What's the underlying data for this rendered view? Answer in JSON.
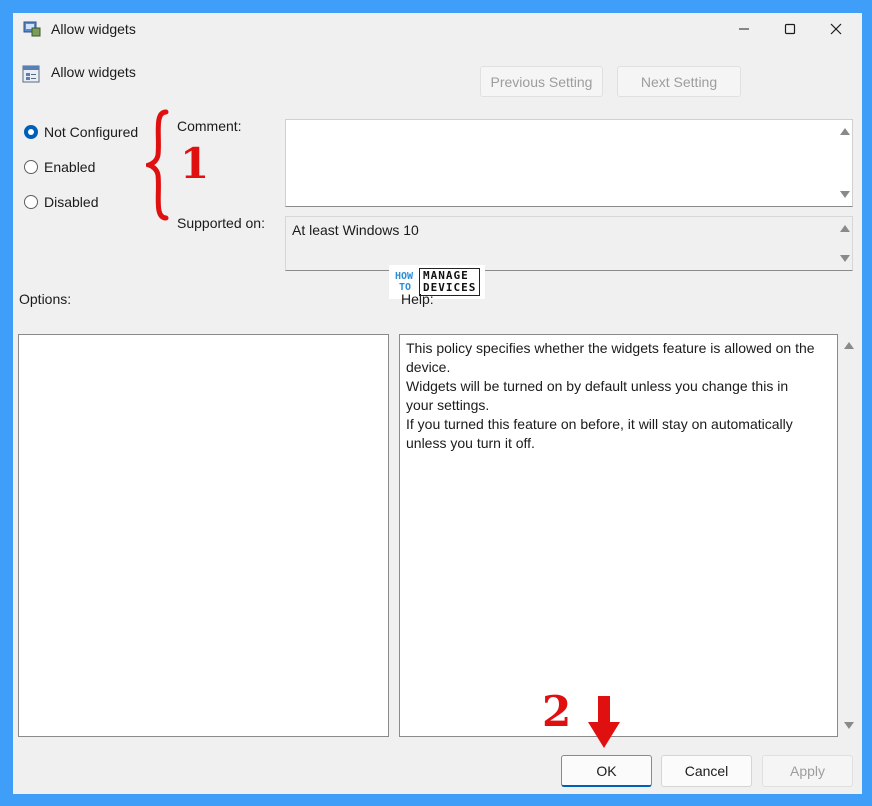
{
  "window": {
    "title": "Allow widgets"
  },
  "header": {
    "policy_title": "Allow widgets",
    "prev_label": "Previous Setting",
    "next_label": "Next Setting"
  },
  "state": {
    "options": [
      {
        "label": "Not Configured",
        "checked": true
      },
      {
        "label": "Enabled",
        "checked": false
      },
      {
        "label": "Disabled",
        "checked": false
      }
    ]
  },
  "comment": {
    "label": "Comment:",
    "value": ""
  },
  "supported": {
    "label": "Supported on:",
    "value": "At least Windows 10"
  },
  "options_label": "Options:",
  "help": {
    "label": "Help:",
    "lines": [
      "This policy specifies whether the widgets feature is allowed on the device.",
      "Widgets will be turned on by default unless you change this in your settings.",
      "If you turned this feature on before, it will stay on automatically unless you turn it off."
    ]
  },
  "footer": {
    "ok_label": "OK",
    "cancel_label": "Cancel",
    "apply_label": "Apply"
  },
  "watermark": {
    "how": "HOW",
    "to": "TO",
    "line1": "MANAGE",
    "line2": "DEVICES"
  },
  "annotations": {
    "num1": "1",
    "num2": "2",
    "color": "#e01010"
  },
  "colors": {
    "accent": "#005fb8",
    "background": "#3f9ef7"
  }
}
